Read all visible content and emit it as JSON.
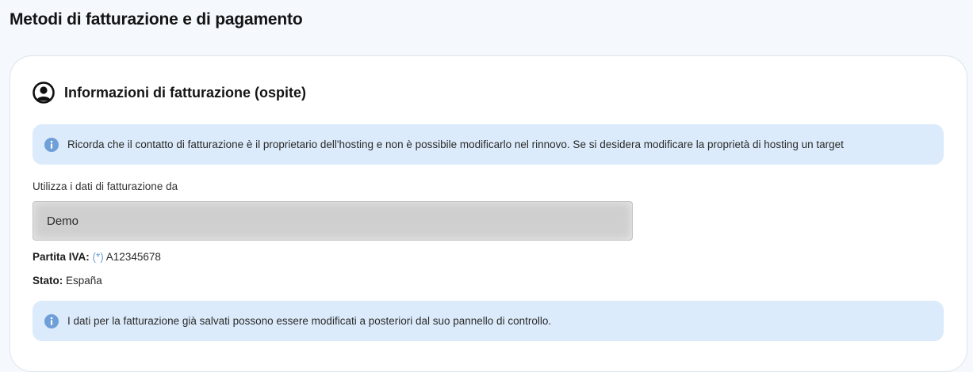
{
  "page": {
    "title": "Metodi di fatturazione e di pagamento"
  },
  "billing": {
    "section_title": "Informazioni di fatturazione (ospite)",
    "section_icon": "user-circle-icon",
    "notice_top": "Ricorda che il contatto di fatturazione è il proprietario dell'hosting e non è possibile modificarlo nel rinnovo. Se si desidera modificare la proprietà di hosting un target",
    "field_label": "Utilizza i dati di fatturazione da",
    "selected_value": "Demo",
    "vat_label": "Partita IVA:",
    "vat_required_mark": "(*)",
    "vat_value": "A12345678",
    "state_label": "Stato:",
    "state_value": "España",
    "notice_bottom": "I dati per la fatturazione già salvati possono essere modificati a posteriori dal suo pannello di controllo.",
    "notice_icon": "info-icon"
  },
  "colors": {
    "background": "#f5f8fc",
    "card": "#ffffff",
    "notice_background": "#dcebfb",
    "info_icon": "#6f9fd8",
    "select_background": "#cfcfcf"
  }
}
